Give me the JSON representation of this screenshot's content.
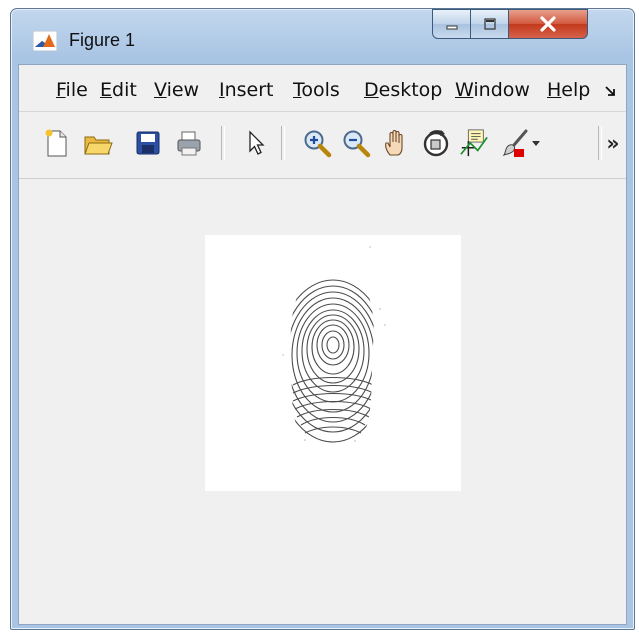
{
  "window": {
    "title": "Figure 1"
  },
  "menu": {
    "items": [
      "File",
      "Edit",
      "View",
      "Insert",
      "Tools",
      "Desktop",
      "Window",
      "Help"
    ],
    "overflow_icon": "chevron-down-right-icon"
  },
  "toolbar": {
    "buttons": [
      "new-figure-icon",
      "open-file-icon",
      "save-figure-icon",
      "print-figure-icon",
      "edit-plot-pointer-icon",
      "zoom-in-icon",
      "zoom-out-icon",
      "pan-hand-icon",
      "rotate-3d-icon",
      "data-cursor-icon",
      "brush-icon",
      "brush-dropdown-icon",
      "toolbar-overflow-icon"
    ],
    "overflow_label": "»"
  },
  "figure": {
    "content": "fingerprint image",
    "background": "#f0f0f0"
  }
}
